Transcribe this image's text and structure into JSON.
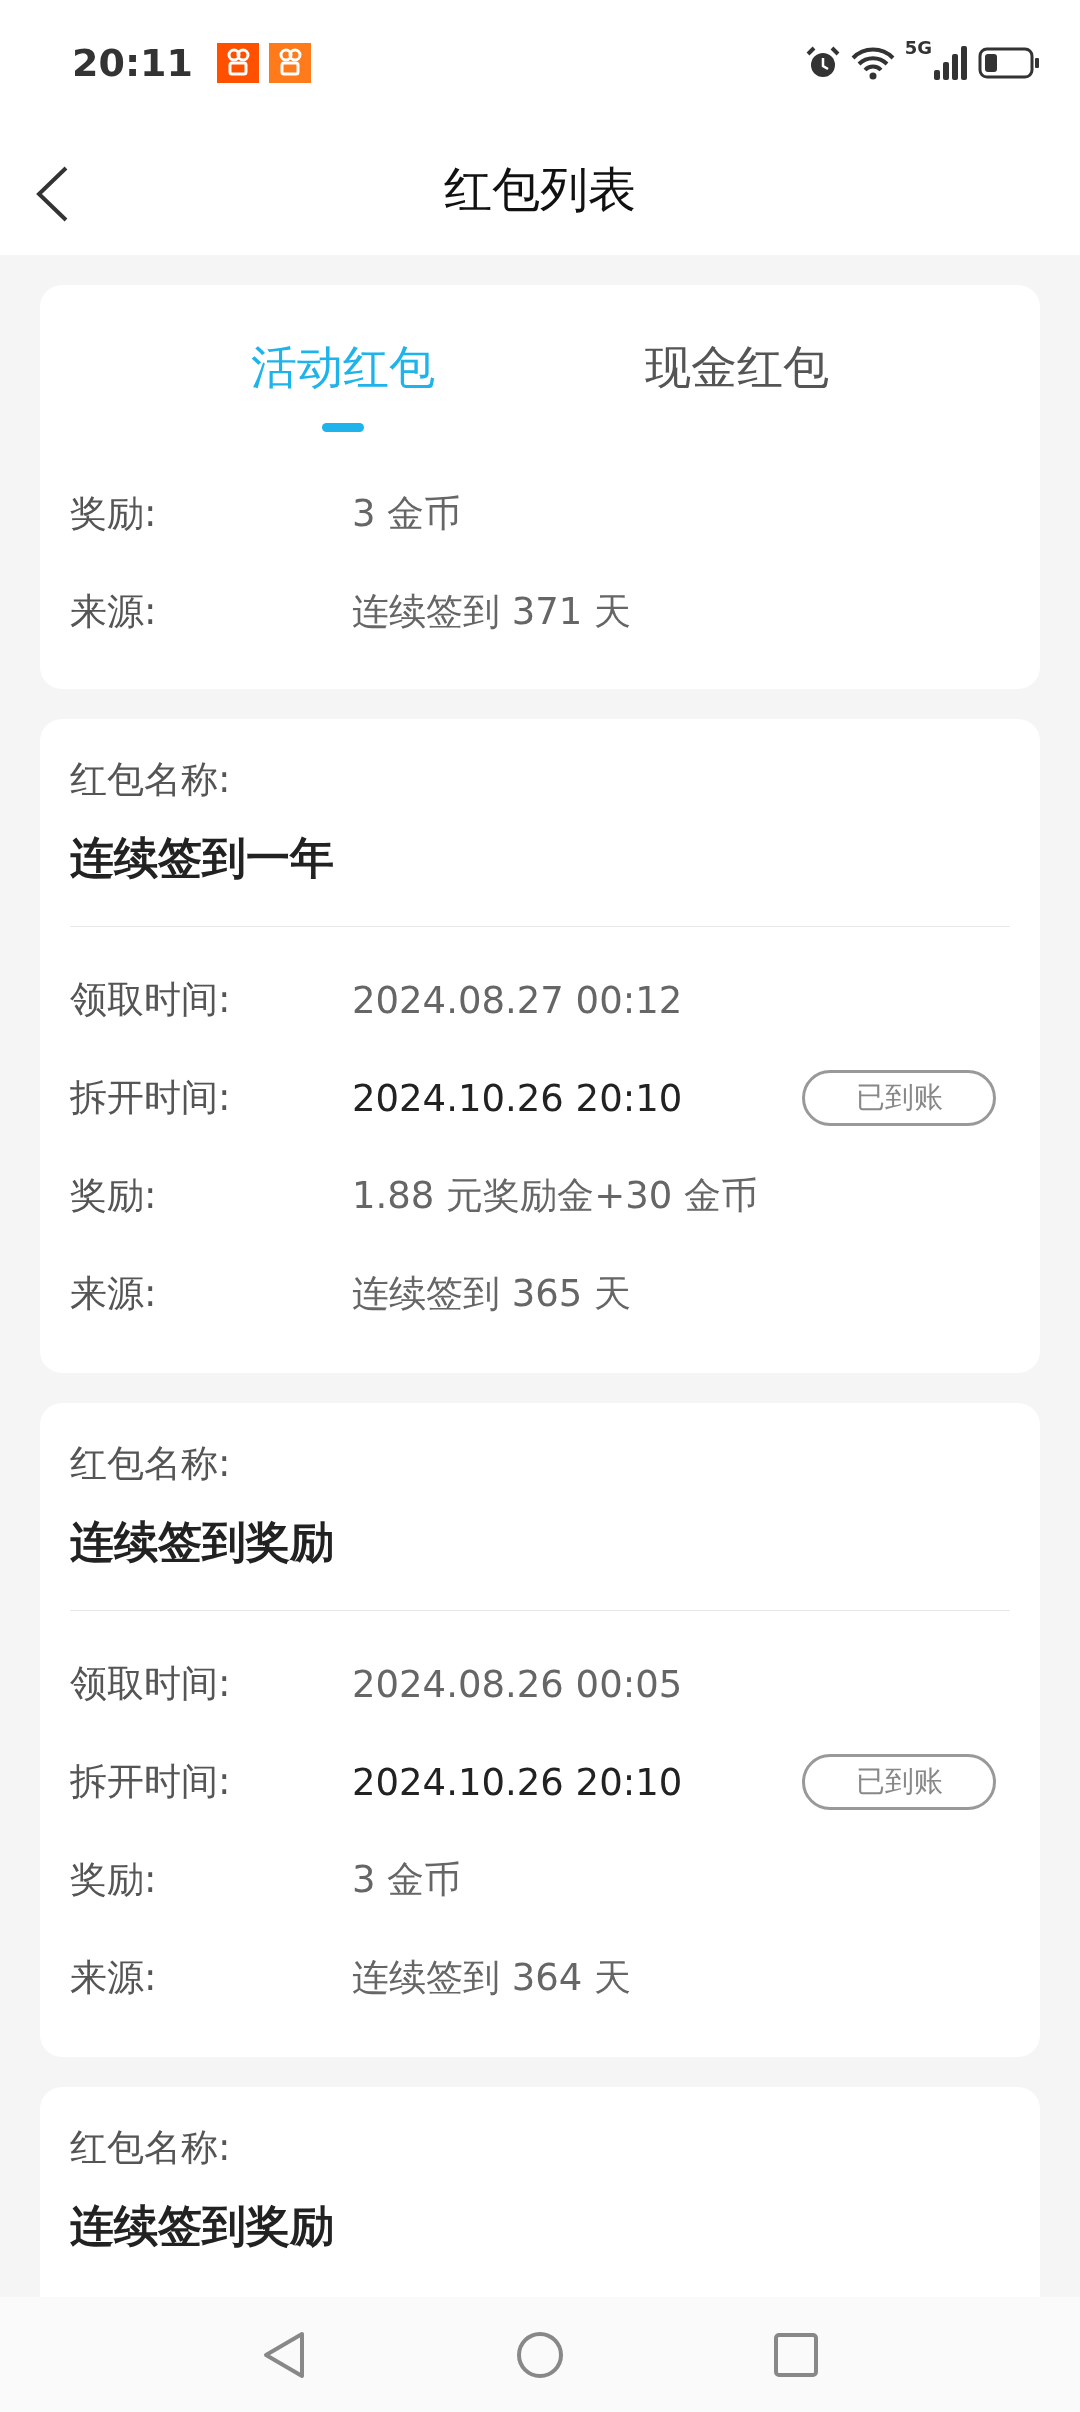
{
  "status_bar": {
    "time": "20:11",
    "network": "5G"
  },
  "header": {
    "title": "红包列表"
  },
  "tabs": [
    {
      "label": "活动红包",
      "selected": true
    },
    {
      "label": "现金红包",
      "selected": false
    }
  ],
  "cards": [
    {
      "rows": [
        {
          "label": "奖励:",
          "value": "3 金币",
          "highlight": false
        },
        {
          "label": "来源:",
          "value": "连续签到 371 天",
          "highlight": false
        }
      ]
    },
    {
      "name_label": "红包名称:",
      "name": "连续签到一年",
      "rows": [
        {
          "label": "领取时间:",
          "value": "2024.08.27 00:12",
          "highlight": false
        },
        {
          "label": "拆开时间:",
          "value": "2024.10.26 20:10",
          "highlight": true,
          "badge": "已到账"
        },
        {
          "label": "奖励:",
          "value": "1.88 元奖励金+30 金币",
          "highlight": false
        },
        {
          "label": "来源:",
          "value": "连续签到 365 天",
          "highlight": false
        }
      ]
    },
    {
      "name_label": "红包名称:",
      "name": "连续签到奖励",
      "rows": [
        {
          "label": "领取时间:",
          "value": "2024.08.26 00:05",
          "highlight": false
        },
        {
          "label": "拆开时间:",
          "value": "2024.10.26 20:10",
          "highlight": true,
          "badge": "已到账"
        },
        {
          "label": "奖励:",
          "value": "3 金币",
          "highlight": false
        },
        {
          "label": "来源:",
          "value": "连续签到 364 天",
          "highlight": false
        }
      ]
    },
    {
      "name_label": "红包名称:",
      "name": "连续签到奖励"
    }
  ]
}
